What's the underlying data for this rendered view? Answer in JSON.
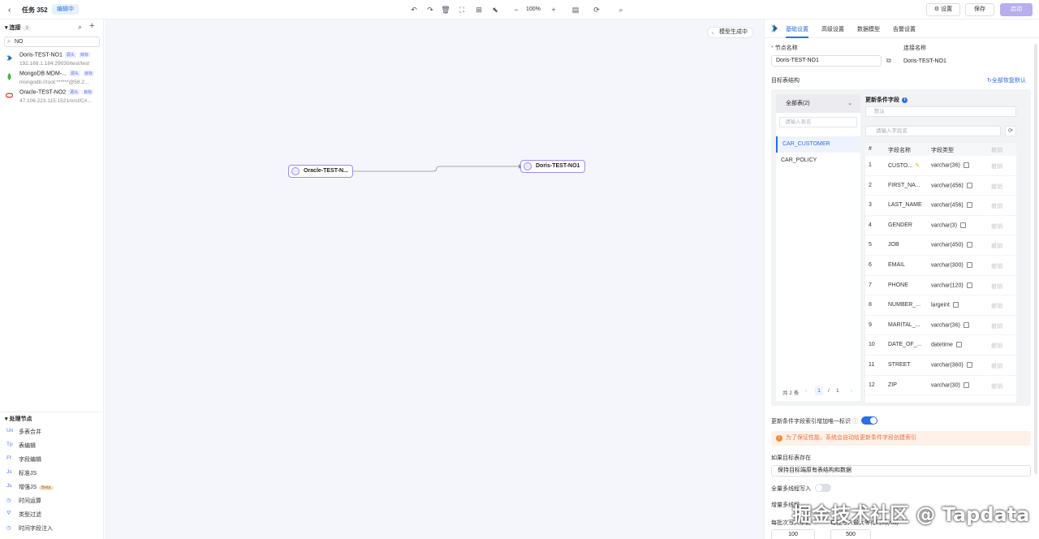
{
  "header": {
    "task_title": "任务 352",
    "status_badge": "编辑中",
    "zoom": "100%",
    "settings_label": "设置",
    "save_label": "保存",
    "start_label": "启动"
  },
  "sidebar": {
    "connections_title": "连接",
    "connections_count": "3",
    "search_value": "NO",
    "connections": [
      {
        "name": "Doris-TEST-NO1",
        "tags": [
          "源头",
          "目标"
        ],
        "url": "192.168.1.184:29030/test/test"
      },
      {
        "name": "MongoDB MDM-...",
        "tags": [
          "源头",
          "目标"
        ],
        "url": "mongodb://root:******@58.2..."
      },
      {
        "name": "Oracle-TEST-NO2",
        "tags": [
          "源头",
          "目标"
        ],
        "url": "47.106.223.115:1521/orcl/C#..."
      }
    ],
    "process_title": "处理节点",
    "process_nodes": [
      {
        "icon": "Un",
        "label": "多表合并"
      },
      {
        "icon": "Tp",
        "label": "表编辑"
      },
      {
        "icon": "Ff",
        "label": "字段编辑"
      },
      {
        "icon": "Js",
        "label": "标准JS"
      },
      {
        "icon": "Js",
        "label": "增强JS",
        "badge": "Beta"
      },
      {
        "icon": "clock",
        "label": "时间运算"
      },
      {
        "icon": "filter",
        "label": "类型过滤"
      },
      {
        "icon": "clock",
        "label": "时间字段注入"
      }
    ]
  },
  "canvas": {
    "model_status": "模型生成中",
    "source_node": "Oracle-TEST-N...",
    "target_node": "Doris-TEST-NO1"
  },
  "panel": {
    "tabs": [
      "基础设置",
      "高级设置",
      "数据模型",
      "告警设置"
    ],
    "node_name_label": "节点名称",
    "node_name_value": "Doris-TEST-NO1",
    "conn_name_label": "连接名称",
    "conn_name_value": "Doris-TEST-NO1",
    "target_struct_label": "目标表结构",
    "restore_all": "全部恢复默认",
    "all_tables": "全部表(2)",
    "table_search_placeholder": "请输入表名",
    "tables": [
      "CAR_CUSTOMER",
      "CAR_POLICY"
    ],
    "pager_total": "共 2 条",
    "pager_current": "1",
    "pager_sep": "/",
    "pager_pages": "1",
    "update_fields_label": "更新条件字段",
    "update_fields_placeholder": "默认",
    "field_search_placeholder": "请输入字段名",
    "columns": [
      "#",
      "字段名称",
      "字段类型",
      "撤销"
    ],
    "fields": [
      {
        "no": "1",
        "name": "CUSTO...",
        "type": "varchar(36)",
        "key": true
      },
      {
        "no": "2",
        "name": "FIRST_NA...",
        "type": "varchar(456)"
      },
      {
        "no": "3",
        "name": "LAST_NAME",
        "type": "varchar(456)"
      },
      {
        "no": "4",
        "name": "GENDER",
        "type": "varchar(3)"
      },
      {
        "no": "5",
        "name": "JOB",
        "type": "varchar(450)"
      },
      {
        "no": "6",
        "name": "EMAIL",
        "type": "varchar(300)"
      },
      {
        "no": "7",
        "name": "PHONE",
        "type": "varchar(120)"
      },
      {
        "no": "8",
        "name": "NUMBER_...",
        "type": "largeint"
      },
      {
        "no": "9",
        "name": "MARITAL_...",
        "type": "varchar(36)"
      },
      {
        "no": "10",
        "name": "DATE_OF_...",
        "type": "datetime"
      },
      {
        "no": "11",
        "name": "STREET",
        "type": "varchar(360)"
      },
      {
        "no": "12",
        "name": "ZIP",
        "type": "varchar(30)"
      }
    ],
    "undo_label": "撤销",
    "unique_index_label": "更新条件字段索引增加唯一标识",
    "unique_index_on": true,
    "warning_text": "为了保证性能，系统会自动给更新条件字段创建索引",
    "if_exists_label": "如果目标表存在",
    "if_exists_value": "保持目标端原有表结构和数据",
    "full_multi_label": "全量多线程写入",
    "full_multi_on": false,
    "incr_multi_label": "增量多线程",
    "batch_label": "每批次写入条数",
    "batch_value": "100",
    "wait_label": "每批写入最大等待时间(ms)",
    "wait_value": "500"
  },
  "watermark": "掘金技术社区 @ Tapdata",
  "colors": {
    "accent": "#2a6ee8",
    "node_border": "#9b8df0",
    "start_button": "#b7aef0",
    "warning_bg": "#fff1e8"
  }
}
